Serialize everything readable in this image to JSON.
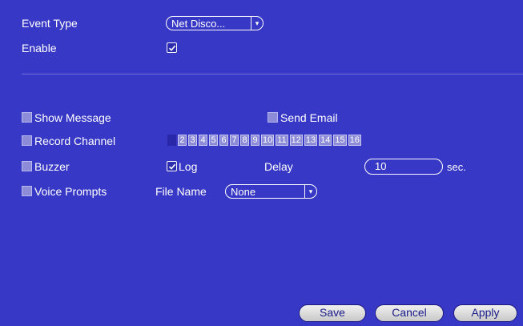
{
  "event_type": {
    "label": "Event Type",
    "value": "Net Disco..."
  },
  "enable": {
    "label": "Enable",
    "checked": true
  },
  "show_message": {
    "label": "Show Message",
    "checked": false
  },
  "send_email": {
    "label": "Send Email",
    "checked": false
  },
  "record_channel": {
    "label": "Record Channel",
    "channels": [
      "1",
      "2",
      "3",
      "4",
      "5",
      "6",
      "7",
      "8",
      "9",
      "10",
      "11",
      "12",
      "13",
      "14",
      "15",
      "16"
    ],
    "selected": [
      1
    ]
  },
  "buzzer": {
    "label": "Buzzer",
    "checked": false
  },
  "log": {
    "label": "Log",
    "checked": true
  },
  "delay": {
    "label": "Delay",
    "value": "10",
    "unit": "sec."
  },
  "voice_prompts": {
    "label": "Voice Prompts",
    "checked": false
  },
  "file_name": {
    "label": "File Name",
    "value": "None"
  },
  "buttons": {
    "save": "Save",
    "cancel": "Cancel",
    "apply": "Apply"
  },
  "colors": {
    "background": "#3838c6",
    "checkbox_off": "#8c8cd8",
    "button_text": "#1a1a8a"
  }
}
